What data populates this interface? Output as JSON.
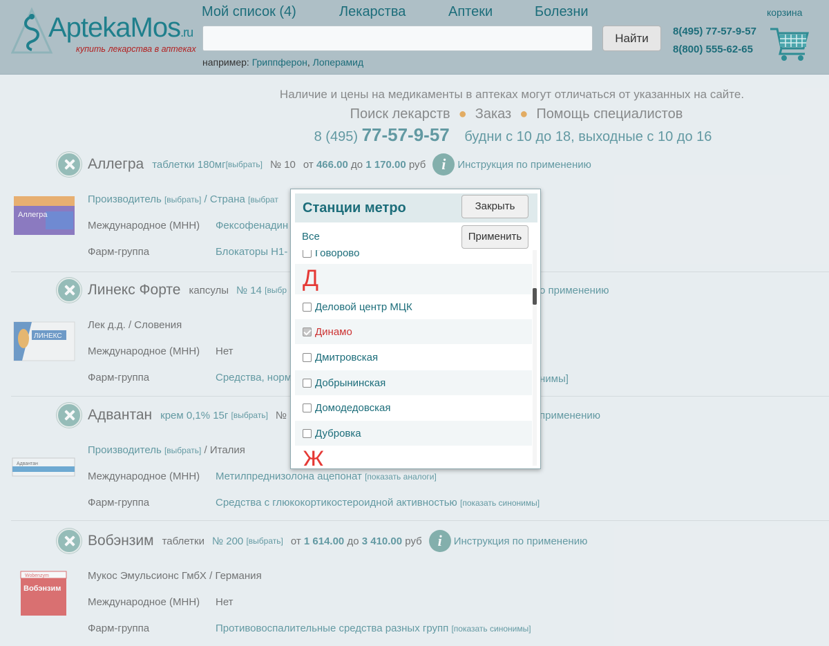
{
  "header": {
    "logo_name_a": "Apteka",
    "logo_name_b": "Mos",
    "logo_ru": ".ru",
    "logo_tagline": "купить лекарства в аптеках",
    "nav": [
      "Мой список (4)",
      "Лекарства",
      "Аптеки",
      "Болезни"
    ],
    "search_placeholder": "",
    "find_label": "Найти",
    "example_prefix": "например:",
    "example_links": [
      "Гриппферон",
      "Лоперамид"
    ],
    "phone1": "8(495) 77-57-9-57",
    "phone2": "8(800) 555-62-65",
    "cart_label": "корзина"
  },
  "notices": {
    "line1": "Наличие и цены на медикаменты в аптеках могут отличаться от указанных на сайте.",
    "services": [
      "Поиск лекарств",
      "Заказ",
      "Помощь специалистов"
    ],
    "phone_prefix": "8 (495)",
    "phone_main": "77-57-9-57",
    "hours": "будни с 10 до 18, выходные с 10 до 16"
  },
  "drugs": [
    {
      "name": "Аллегра",
      "form": "таблетки 180мг",
      "choose": "[выбрать]",
      "count": "№ 10",
      "price_from": "от",
      "price_min": "466.00",
      "price_to": "до",
      "price_max": "1 170.00",
      "currency": "руб",
      "instruction": "Инструкция по применению",
      "manufacturer_label": "Производитель",
      "manufacturer_choose": "[выбрать]",
      "country": "/ Страна",
      "country_choose": "[выбрат",
      "inn_label": "Международное (МНН)",
      "inn_value": "Фексофенадин",
      "group_label": "Фарм-группа",
      "group_value": "Блокаторы Н1-"
    },
    {
      "name": "Линекс Форте",
      "form": "капсулы",
      "count": "№ 14",
      "choose": "[выбр",
      "instruction_tail": "о применению",
      "manufacturer": "Лек д.д.",
      "country": "/ Словения",
      "inn_label": "Международное (МНН)",
      "inn_value": "Нет",
      "group_label": "Фарм-группа",
      "group_value": "Средства, норм",
      "group_tail": "нимы]"
    },
    {
      "name": "Адвантан",
      "form": "крем 0,1% 15г",
      "choose": "[выбрать]",
      "count": "№",
      "instruction_tail": "применению",
      "manufacturer_label": "Производитель",
      "manufacturer_choose": "[выбрать]",
      "country": "/ Италия",
      "inn_label": "Международное (МНН)",
      "inn_value": "Метилпреднизолона ацепонат",
      "inn_extra": "[показать аналоги]",
      "group_label": "Фарм-группа",
      "group_value": "Средства с глюкокортикостероидной активностью",
      "group_extra": "[показать синонимы]"
    },
    {
      "name": "Вобэнзим",
      "form": "таблетки",
      "count": "№ 200",
      "choose": "[выбрать]",
      "price_from": "от",
      "price_min": "1 614.00",
      "price_to": "до",
      "price_max": "3 410.00",
      "currency": "руб",
      "instruction": "Инструкция по применению",
      "manufacturer": "Мукос Эмульсионс ГмбХ",
      "country": "/ Германия",
      "inn_label": "Международное (МНН)",
      "inn_value": "Нет",
      "group_label": "Фарм-группа",
      "group_value": "Противовоспалительные средства разных групп",
      "group_extra": "[показать синонимы]"
    }
  ],
  "metro_modal": {
    "title": "Станции метро",
    "close_label": "Закрыть",
    "apply_label": "Применить",
    "all_label": "Все",
    "stations_top": "Говорово",
    "letter_d": "Д",
    "stations": [
      {
        "name": "Деловой центр МЦК",
        "checked": false
      },
      {
        "name": "Динамо",
        "checked": true
      },
      {
        "name": "Дмитровская",
        "checked": false
      },
      {
        "name": "Добрынинская",
        "checked": false
      },
      {
        "name": "Домодедовская",
        "checked": false
      },
      {
        "name": "Дубровка",
        "checked": false
      }
    ],
    "letter_zh": "Ж"
  }
}
